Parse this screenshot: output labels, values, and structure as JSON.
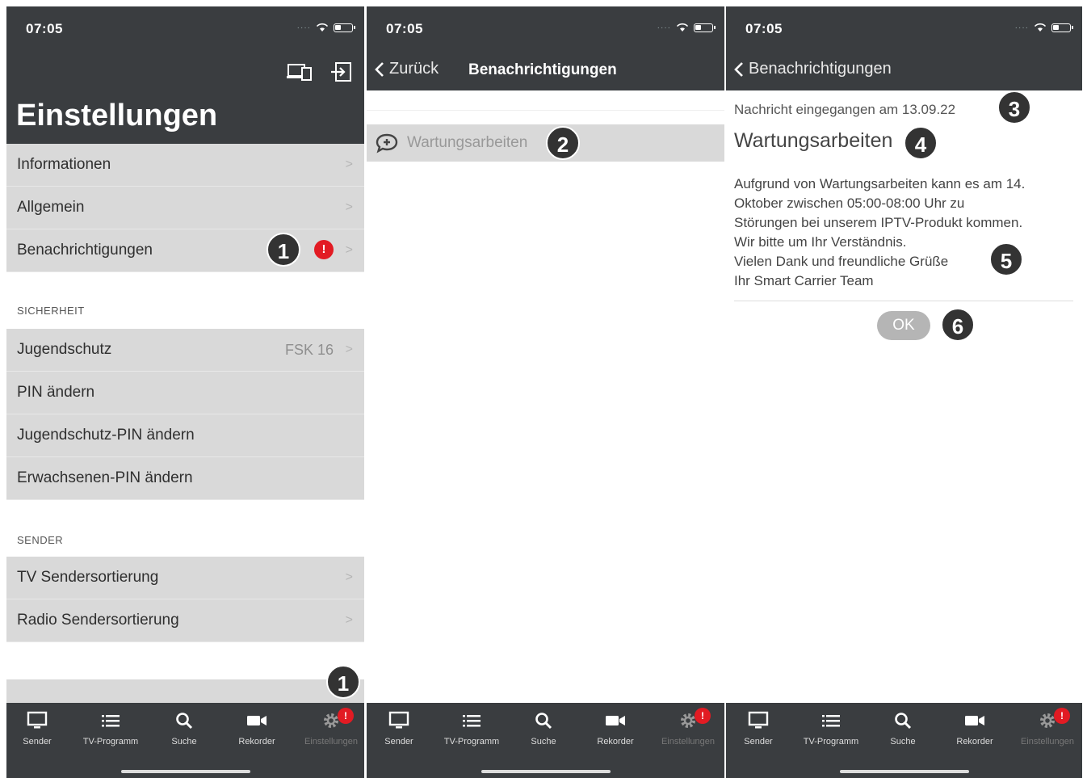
{
  "status": {
    "time": "07:05"
  },
  "panel1": {
    "title": "Einstellungen",
    "rows_top": [
      {
        "label": "Informationen"
      },
      {
        "label": "Allgemein"
      },
      {
        "label": "Benachrichtigungen",
        "badge": "!"
      }
    ],
    "section_security": "SICHERHEIT",
    "rows_security": [
      {
        "label": "Jugendschutz",
        "value": "FSK 16"
      },
      {
        "label": "PIN ändern"
      },
      {
        "label": "Jugendschutz-PIN ändern"
      },
      {
        "label": "Erwachsenen-PIN ändern"
      }
    ],
    "section_sender": "SENDER",
    "rows_sender": [
      {
        "label": "TV Sendersortierung"
      },
      {
        "label": "Radio Sendersortierung"
      }
    ]
  },
  "panel2": {
    "back_label": "Zurück",
    "title": "Benachrichtigungen",
    "notification": "Wartungsarbeiten"
  },
  "panel3": {
    "back_label": "Benachrichtigungen",
    "received": "Nachricht eingegangen am 13.09.22",
    "message_title": "Wartungsarbeiten",
    "message_lines": [
      "Aufgrund von Wartungsarbeiten kann es am 14.",
      "Oktober zwischen 05:00-08:00 Uhr zu",
      "Störungen bei unserem IPTV-Produkt kommen.",
      "Wir bitte um Ihr Verständnis.",
      "Vielen Dank und freundliche Grüße",
      "Ihr Smart Carrier Team"
    ],
    "ok_label": "OK"
  },
  "tabbar": {
    "tabs": [
      "Sender",
      "TV-Programm",
      "Suche",
      "Rekorder",
      "Einstellungen"
    ],
    "badge": "!"
  },
  "callouts": [
    "1",
    "1",
    "2",
    "3",
    "4",
    "5",
    "6"
  ],
  "colors": {
    "header": "#3a3d40",
    "row": "#d9d9d9",
    "badge": "#e21b23",
    "callout": "#333333"
  }
}
